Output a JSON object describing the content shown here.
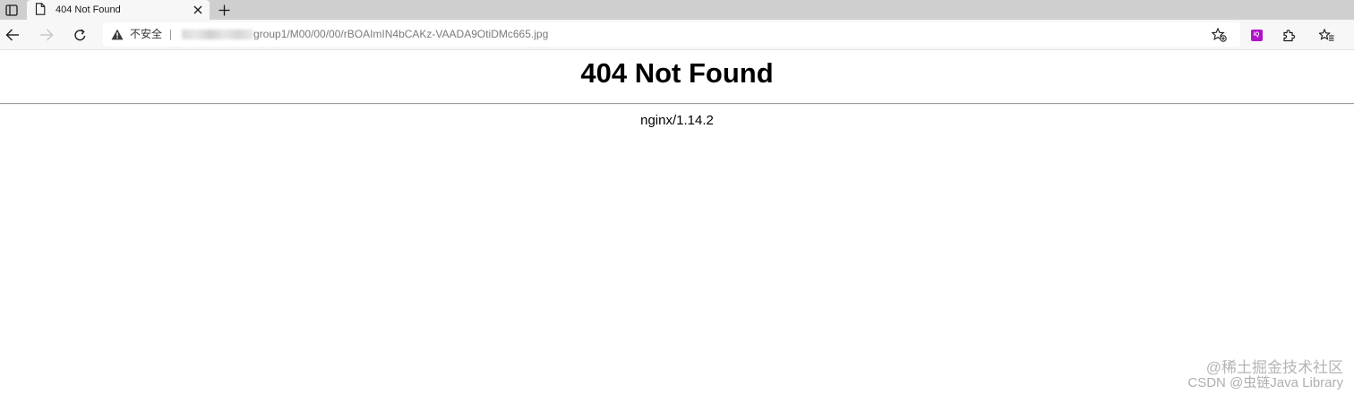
{
  "browser": {
    "tab": {
      "title": "404 Not Found"
    },
    "address_bar": {
      "security_label": "不安全",
      "url_path": "group1/M00/00/00/rBOAImIN4bCAKz-VAADA9OtiDMc665.jpg"
    },
    "extension_badge_text": "iQ"
  },
  "page": {
    "heading": "404 Not Found",
    "server": "nginx/1.14.2"
  },
  "watermark": {
    "line1": "@稀土掘金技术社区",
    "line2": "CSDN @虫链Java Library"
  },
  "colors": {
    "tabstrip": "#cfcfcf",
    "toolbar": "#f7f7f7",
    "extension_accent": "#b012c9"
  }
}
